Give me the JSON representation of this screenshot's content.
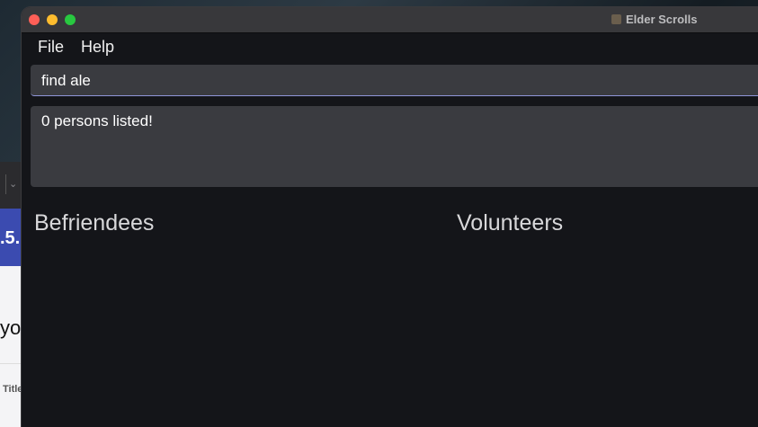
{
  "background": {
    "version_fragment": ".5.",
    "big_text_fragment": "you",
    "small_text_fragment": "Title",
    "chevron": "⌄"
  },
  "window": {
    "title": "Elder Scrolls",
    "app_icon": "app-icon"
  },
  "menu": {
    "items": [
      {
        "label": "File"
      },
      {
        "label": "Help"
      }
    ]
  },
  "command": {
    "value": "find ale"
  },
  "result": {
    "message": "0 persons listed!"
  },
  "panels": {
    "befriendees_title": "Befriendees",
    "volunteers_title": "Volunteers"
  },
  "colors": {
    "accent": "#8f95d9",
    "window_bg": "#141519",
    "box_bg": "#3a3b40",
    "close": "#ff5f57",
    "minimize": "#febc2e",
    "zoom": "#28c840"
  }
}
